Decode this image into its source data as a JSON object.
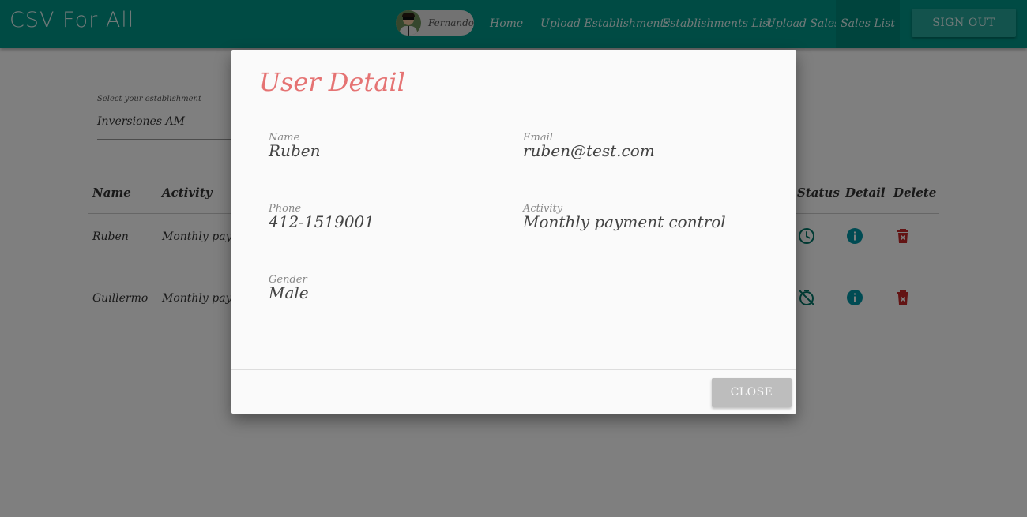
{
  "app": {
    "brand": "CSV For All"
  },
  "nav": {
    "user_name": "Fernando",
    "links": [
      "Home",
      "Upload Establishments",
      "Establishments List",
      "Upload Sales",
      "Sales List"
    ],
    "active_link": "Sales List",
    "signout_label": "SIGN OUT"
  },
  "page": {
    "select_label": "Select your establishment",
    "select_value": "Inversiones AM",
    "table": {
      "headers": {
        "name": "Name",
        "activity": "Activity",
        "status": "Status",
        "detail": "Detail",
        "delete": "Delete"
      },
      "rows": [
        {
          "name": "Ruben",
          "activity": "Monthly payment control",
          "status_icon": "clock-icon"
        },
        {
          "name": "Guillermo",
          "activity": "Monthly payment control",
          "status_icon": "timer-off-icon"
        }
      ]
    }
  },
  "modal": {
    "title": "User Detail",
    "fields": {
      "name": {
        "label": "Name",
        "value": "Ruben"
      },
      "email": {
        "label": "Email",
        "value": "ruben@test.com"
      },
      "phone": {
        "label": "Phone",
        "value": "412-1519001"
      },
      "activity": {
        "label": "Activity",
        "value": "Monthly payment control"
      },
      "gender": {
        "label": "Gender",
        "value": "Male"
      }
    },
    "close_label": "CLOSE"
  },
  "colors": {
    "primary": "#009688",
    "accent_title": "#e57373",
    "status_icon": "#00796b",
    "detail_icon": "#0097a7",
    "delete_icon": "#c62828"
  }
}
